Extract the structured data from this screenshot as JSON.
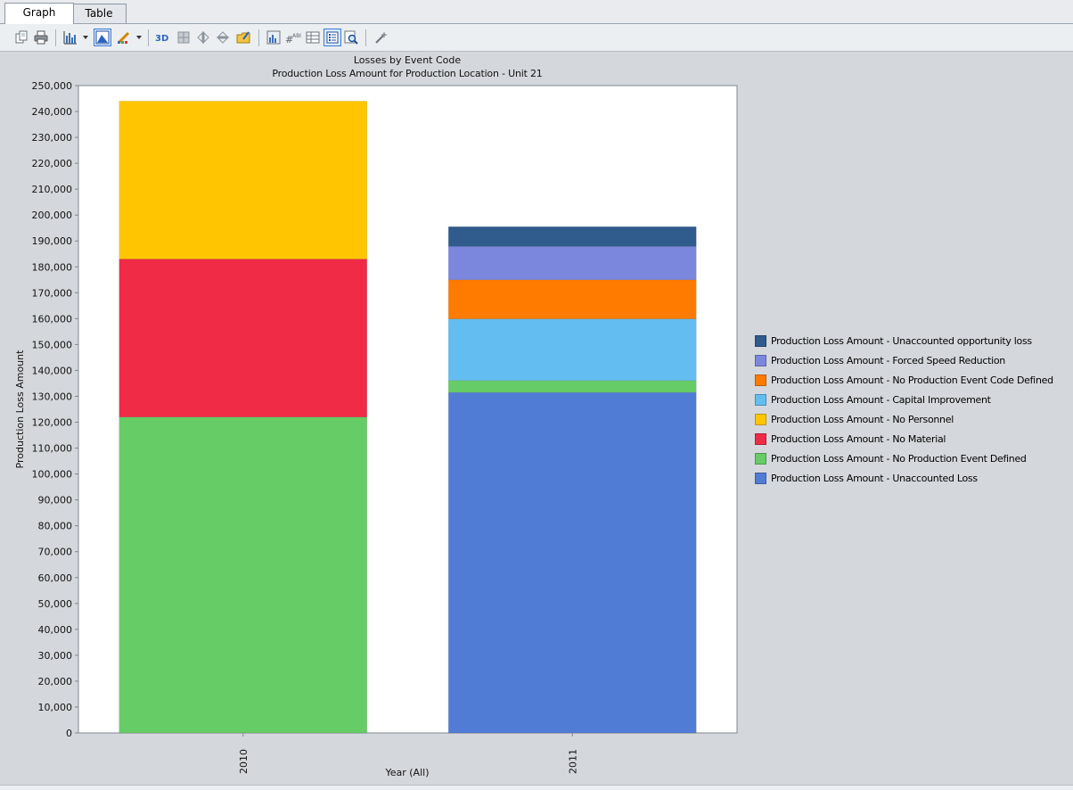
{
  "tabs": [
    {
      "label": "Graph",
      "active": true
    },
    {
      "label": "Table",
      "active": false
    }
  ],
  "toolbar": {
    "icons": [
      "copy-icon",
      "print-icon",
      "chart-type-icon",
      "chart-area-icon",
      "series-style-icon",
      "3d-view-icon",
      "rotate-icon",
      "flip-horizontal-icon",
      "flip-vertical-icon",
      "export-icon",
      "chart-properties-icon",
      "data-labels-icon",
      "data-table-icon",
      "legend-icon",
      "zoom-icon",
      "chart-wizard-icon"
    ]
  },
  "chart_data": {
    "type": "bar",
    "stacked": true,
    "title": "Losses by Event Code",
    "subtitle": "Production Loss Amount for Production Location - Unit 21",
    "xlabel": "Year (All)",
    "ylabel": "Production Loss Amount",
    "ylim": [
      0,
      250000
    ],
    "ytick_step": 10000,
    "ytick_labels": [
      "0",
      "10,000",
      "20,000",
      "30,000",
      "40,000",
      "50,000",
      "60,000",
      "70,000",
      "80,000",
      "90,000",
      "100,000",
      "110,000",
      "120,000",
      "130,000",
      "140,000",
      "150,000",
      "160,000",
      "170,000",
      "180,000",
      "190,000",
      "200,000",
      "210,000",
      "220,000",
      "230,000",
      "240,000",
      "250,000"
    ],
    "categories": [
      "2010",
      "2011"
    ],
    "grid": false,
    "legend_position": "right",
    "series": [
      {
        "name": "Production Loss Amount - Unaccounted opportunity loss",
        "color": "#2f5b8d",
        "values": [
          0,
          7600
        ]
      },
      {
        "name": "Production Loss Amount - Forced Speed Reduction",
        "color": "#7b87dd",
        "values": [
          0,
          12900
        ]
      },
      {
        "name": "Production Loss Amount - No Production Event Code Defined",
        "color": "#ff7b00",
        "values": [
          0,
          15100
        ]
      },
      {
        "name": "Production Loss Amount - Capital Improvement",
        "color": "#63bdf0",
        "values": [
          0,
          23800
        ]
      },
      {
        "name": "Production Loss Amount - No Personnel",
        "color": "#ffc600",
        "values": [
          61000,
          0
        ]
      },
      {
        "name": "Production Loss Amount - No Material",
        "color": "#ef2b46",
        "values": [
          61000,
          0
        ]
      },
      {
        "name": "Production Loss Amount - No Production Event Defined",
        "color": "#66cc66",
        "values": [
          122000,
          4600
        ]
      },
      {
        "name": "Production Loss Amount - Unaccounted Loss",
        "color": "#517cd6",
        "values": [
          0,
          131500
        ]
      }
    ]
  }
}
